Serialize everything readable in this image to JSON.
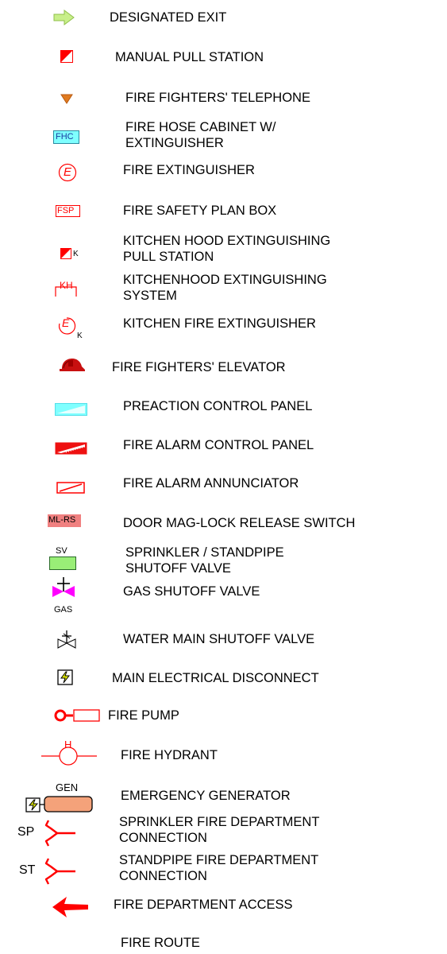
{
  "legend": [
    {
      "label": "DESIGNATED EXIT",
      "icon": "exit-arrow-icon"
    },
    {
      "label": "MANUAL PULL STATION",
      "icon": "pull-station-icon"
    },
    {
      "label": "FIRE FIGHTERS' TELEPHONE",
      "icon": "telephone-triangle-icon"
    },
    {
      "label_lines": [
        "FIRE HOSE CABINET W/",
        "EXTINGUISHER"
      ],
      "icon": "hose-cabinet-icon",
      "icon_text": "FHC"
    },
    {
      "label": "FIRE EXTINGUISHER",
      "icon": "extinguisher-icon",
      "icon_text": "E"
    },
    {
      "label": "FIRE SAFETY PLAN BOX",
      "icon": "safety-plan-box-icon",
      "icon_text": "FSP"
    },
    {
      "label_lines": [
        "KITCHEN HOOD EXTINGUISHING",
        "PULL STATION"
      ],
      "icon": "kitchen-pull-station-icon",
      "icon_text": "K"
    },
    {
      "label_lines": [
        "KITCHENHOOD EXTINGUISHING",
        "SYSTEM"
      ],
      "icon": "kitchen-hood-system-icon",
      "icon_text": "KH"
    },
    {
      "label": "KITCHEN FIRE EXTINGUISHER",
      "icon": "kitchen-extinguisher-icon",
      "icon_text": "E",
      "icon_sub": "K"
    },
    {
      "label": "FIRE FIGHTERS' ELEVATOR",
      "icon": "firefighter-helmet-icon"
    },
    {
      "label": "PREACTION CONTROL PANEL",
      "icon": "preaction-panel-icon"
    },
    {
      "label": "FIRE ALARM CONTROL PANEL",
      "icon": "alarm-control-panel-icon"
    },
    {
      "label": "FIRE ALARM ANNUNCIATOR",
      "icon": "annunciator-icon"
    },
    {
      "label": "DOOR MAG-LOCK RELEASE SWITCH",
      "icon": "maglock-switch-icon",
      "icon_text": "ML-RS"
    },
    {
      "label_lines": [
        "SPRINKLER / STANDPIPE",
        "SHUTOFF VALVE"
      ],
      "icon": "sprinkler-valve-icon",
      "icon_text": "SV"
    },
    {
      "label": "GAS SHUTOFF VALVE",
      "icon": "gas-valve-icon",
      "icon_text": "GAS"
    },
    {
      "label": "WATER MAIN SHUTOFF VALVE",
      "icon": "water-valve-icon"
    },
    {
      "label": "MAIN ELECTRICAL DISCONNECT",
      "icon": "electrical-disconnect-icon"
    },
    {
      "label": "FIRE PUMP",
      "icon": "fire-pump-icon"
    },
    {
      "label": "FIRE HYDRANT",
      "icon": "fire-hydrant-icon",
      "icon_text": "H"
    },
    {
      "label": "EMERGENCY GENERATOR",
      "icon": "generator-icon",
      "icon_text": "GEN"
    },
    {
      "label_lines": [
        "SPRINKLER FIRE DEPARTMENT",
        "CONNECTION"
      ],
      "icon": "sprinkler-connection-icon",
      "icon_text": "SP"
    },
    {
      "label_lines": [
        "STANDPIPE FIRE DEPARTMENT",
        "CONNECTION"
      ],
      "icon": "standpipe-connection-icon",
      "icon_text": "ST"
    },
    {
      "label": "FIRE DEPARTMENT ACCESS",
      "icon": "access-arrow-icon"
    },
    {
      "label": "FIRE ROUTE",
      "icon": "none"
    }
  ],
  "colors": {
    "red": "#ff0000",
    "green_arrow": "#c8ef8a",
    "cyan": "#7fffff",
    "magenta": "#ff00ff",
    "green_valve": "#99ee77",
    "salmon": "#f4a27a",
    "orange": "#e07a1f",
    "dark_red": "#c81010"
  }
}
